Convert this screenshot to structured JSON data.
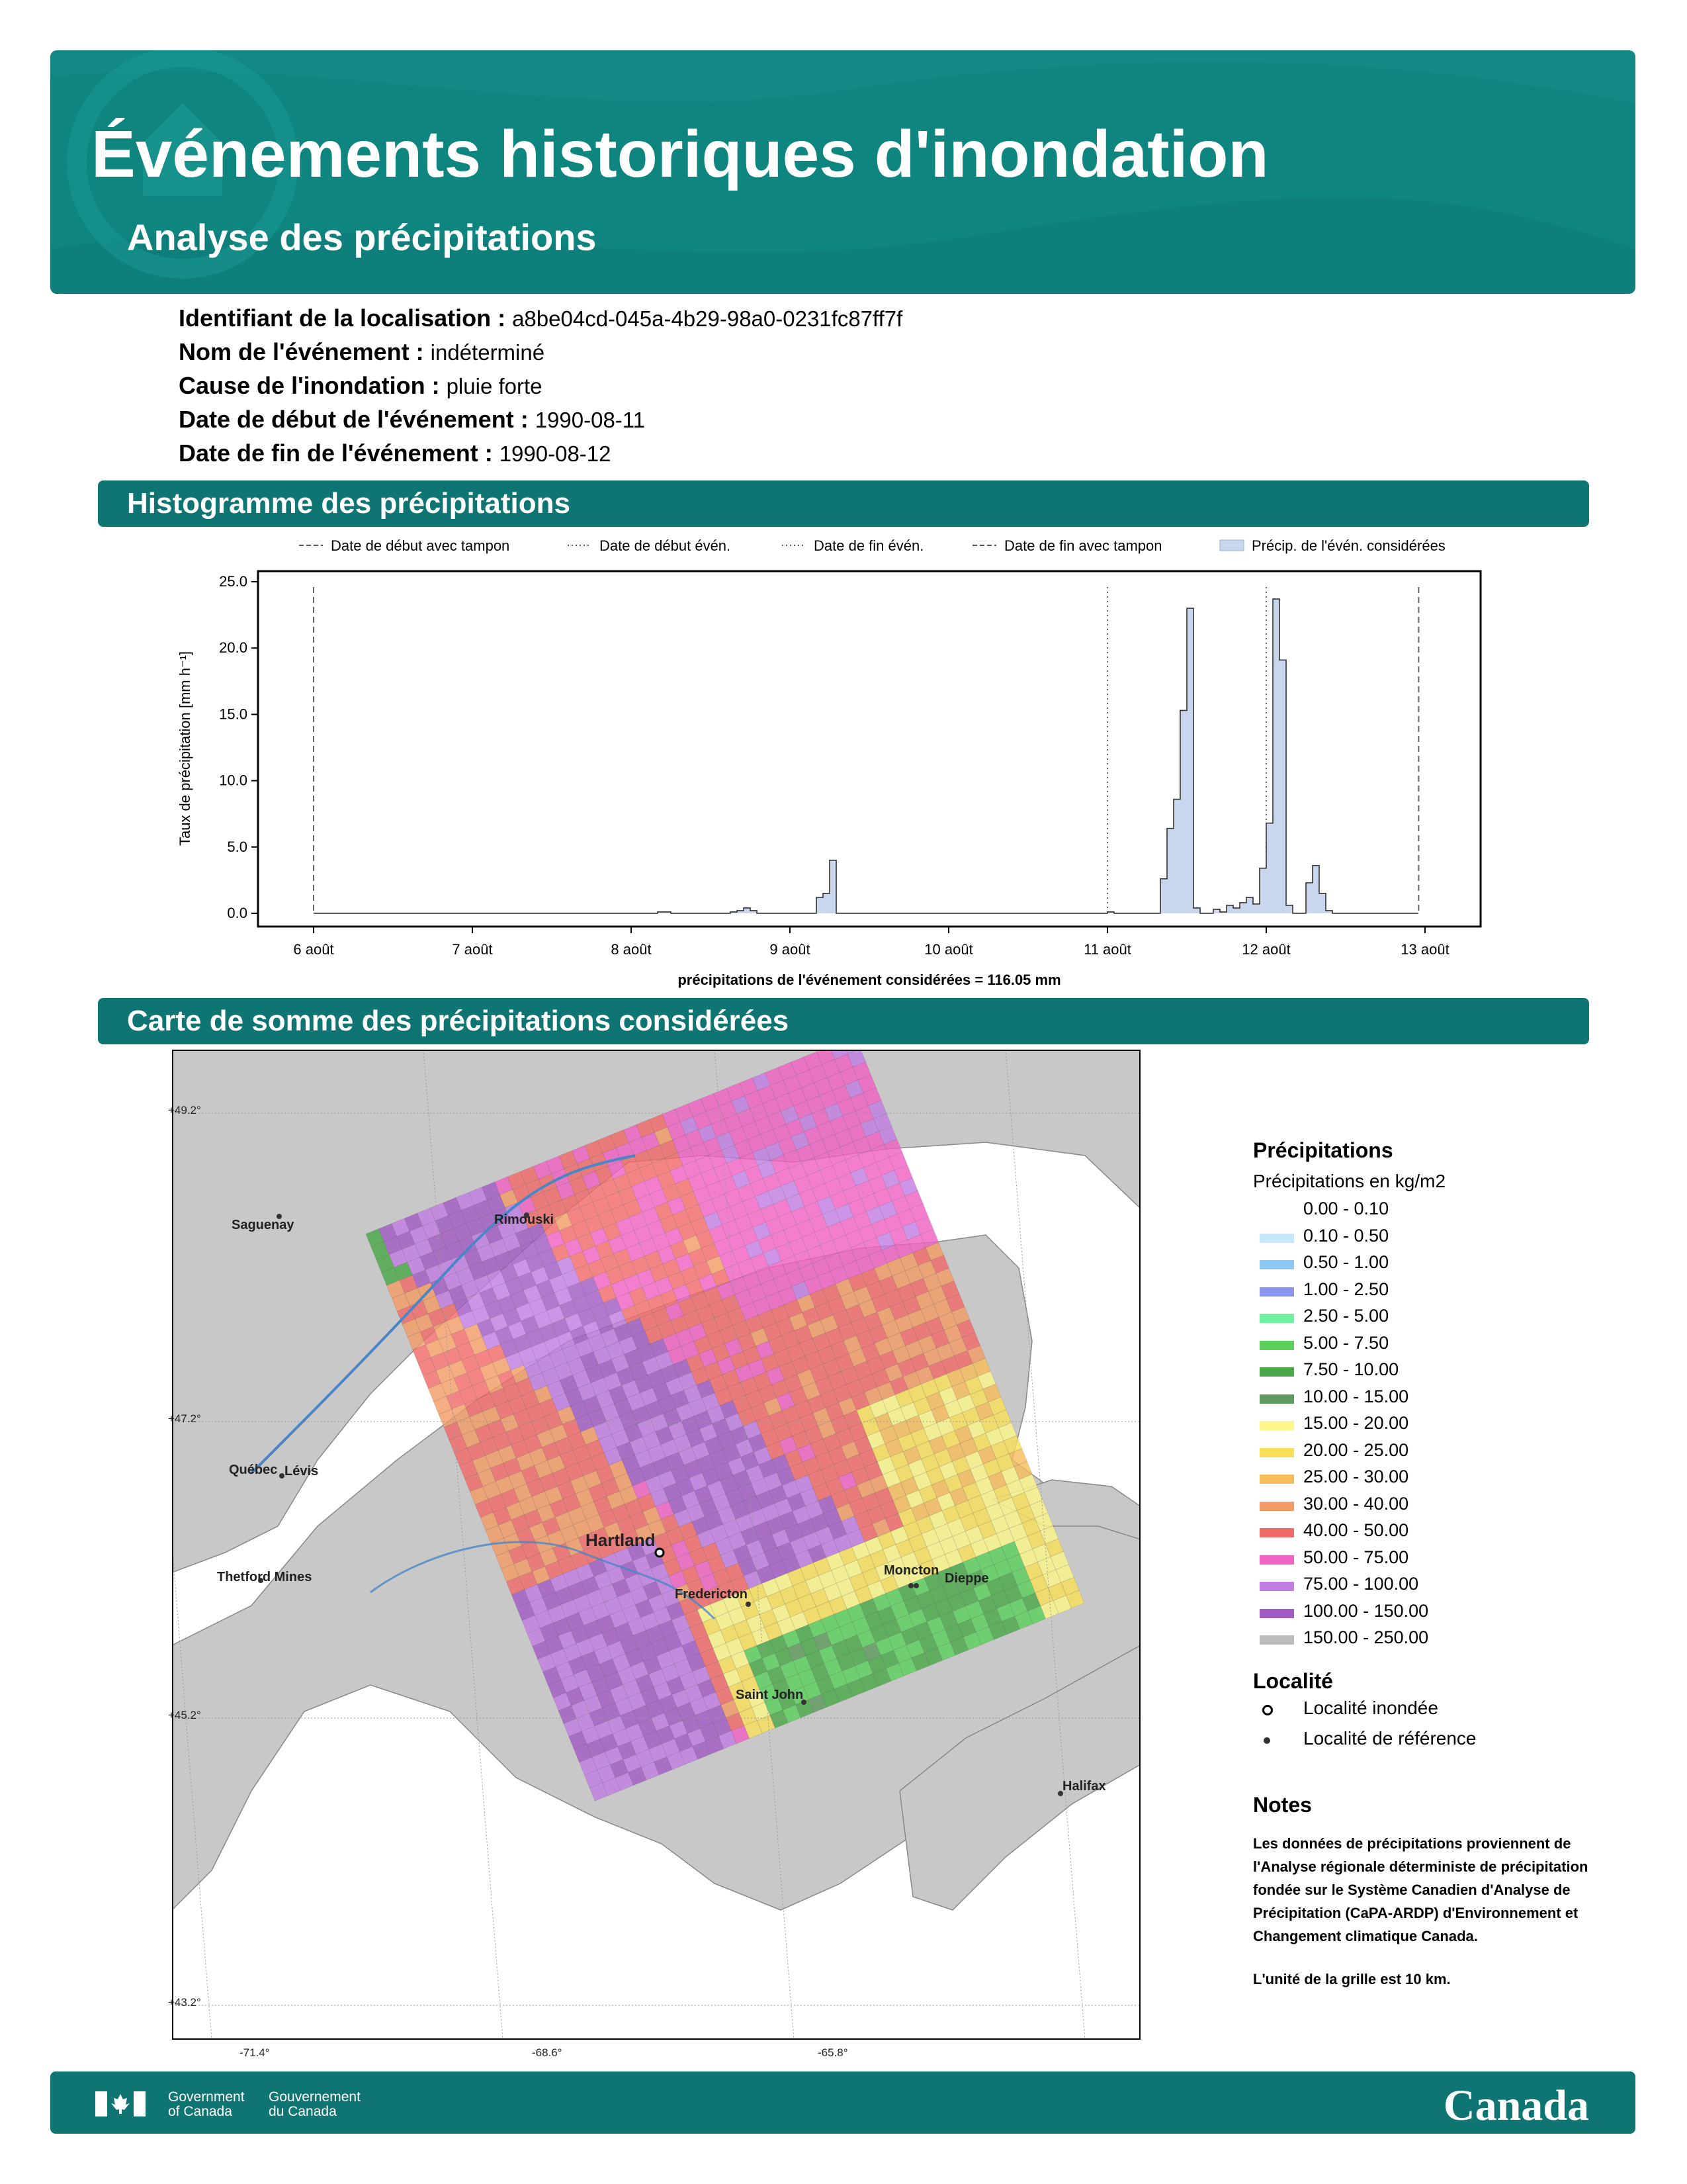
{
  "header": {
    "title": "Événements historiques d'inondation",
    "subtitle": "Analyse des précipitations"
  },
  "info": [
    {
      "label": "Identifiant de la localisation :",
      "value": "a8be04cd-045a-4b29-98a0-0231fc87ff7f"
    },
    {
      "label": "Nom de l'événement :",
      "value": "indéterminé"
    },
    {
      "label": "Cause de l'inondation :",
      "value": "pluie forte"
    },
    {
      "label": "Date de début de l'événement :",
      "value": "1990-08-11"
    },
    {
      "label": "Date de fin de l'événement :",
      "value": "1990-08-12"
    }
  ],
  "sections": {
    "histogram": "Histogramme des précipitations",
    "map": "Carte de somme des précipitations considérées"
  },
  "chart_data": {
    "type": "area",
    "legend": [
      {
        "label": "Date de début avec tampon",
        "style": "dashed"
      },
      {
        "label": "Date de début évén.",
        "style": "dotted"
      },
      {
        "label": "Date de fin évén.",
        "style": "dotted"
      },
      {
        "label": "Date de fin avec tampon",
        "style": "dashed"
      },
      {
        "label": "Précip. de l'évén. considérées",
        "style": "fill"
      }
    ],
    "legend_position": "top",
    "ylabel": "Taux de précipitation [mm h⁻¹]",
    "xlabel": "précipitations de l'événement considérées = 116.05 mm",
    "yticks": [
      "0.0",
      "5.0",
      "10.0",
      "15.0",
      "20.0",
      "25.0"
    ],
    "ylim": [
      -1,
      25.8
    ],
    "xlim_days": [
      5.65,
      13.35
    ],
    "xticks": [
      {
        "day": 6,
        "label": "6 août"
      },
      {
        "day": 7,
        "label": "7 août"
      },
      {
        "day": 8,
        "label": "8 août"
      },
      {
        "day": 9,
        "label": "9 août"
      },
      {
        "day": 10,
        "label": "10 août"
      },
      {
        "day": 11,
        "label": "11 août"
      },
      {
        "day": 12,
        "label": "12 août"
      },
      {
        "day": 13,
        "label": "13 août"
      }
    ],
    "buffer_start_day": 6.0,
    "event_start_day": 11.0,
    "event_end_day": 12.0,
    "buffer_end_day": 12.96,
    "grid": false,
    "series": [
      {
        "values_from_day": 6,
        "step_hours": 1,
        "values": [
          0,
          0,
          0,
          0,
          0,
          0,
          0,
          0,
          0,
          0,
          0,
          0,
          0,
          0,
          0,
          0,
          0,
          0,
          0,
          0,
          0,
          0,
          0,
          0,
          0,
          0,
          0,
          0,
          0,
          0,
          0,
          0,
          0,
          0,
          0,
          0,
          0,
          0,
          0,
          0,
          0,
          0,
          0,
          0,
          0,
          0,
          0,
          0,
          0,
          0,
          0,
          0,
          0.1,
          0.1,
          0,
          0,
          0,
          0,
          0,
          0,
          0,
          0,
          0,
          0.1,
          0.2,
          0.4,
          0.2,
          0,
          0,
          0,
          0,
          0,
          0,
          0,
          0,
          0,
          1.2,
          1.5,
          4.0,
          0,
          0,
          0,
          0,
          0,
          0,
          0,
          0,
          0,
          0,
          0,
          0,
          0,
          0,
          0,
          0,
          0,
          0,
          0,
          0,
          0,
          0,
          0,
          0,
          0,
          0,
          0,
          0,
          0,
          0,
          0,
          0,
          0,
          0,
          0,
          0,
          0,
          0,
          0,
          0,
          0,
          0.1,
          0,
          0,
          0,
          0,
          0,
          0,
          0,
          2.6,
          6.4,
          8.6,
          15.3,
          23.0,
          0.4,
          0,
          0,
          0.3,
          0.1,
          0.6,
          0.4,
          0.8,
          1.2,
          0.7,
          3.4,
          6.8,
          23.7,
          19.1,
          0.6,
          0,
          0,
          2.3,
          3.6,
          1.5,
          0.2,
          0,
          0,
          0,
          0,
          0,
          0,
          0,
          0,
          0,
          0,
          0,
          0,
          0
        ]
      }
    ]
  },
  "map": {
    "cities": [
      {
        "name": "Saguenay"
      },
      {
        "name": "Rimouski"
      },
      {
        "name": "Québec"
      },
      {
        "name": "Lévis"
      },
      {
        "name": "Thetford Mines"
      },
      {
        "name": "Hartland"
      },
      {
        "name": "Fredericton"
      },
      {
        "name": "Moncton"
      },
      {
        "name": "Dieppe"
      },
      {
        "name": "Saint John"
      },
      {
        "name": "Halifax"
      }
    ],
    "lat_labels": [
      "+49.2°",
      "+47.2°",
      "+45.2°",
      "+43.2°"
    ],
    "lon_labels": [
      "-71.4°",
      "-68.6°",
      "-65.8°"
    ]
  },
  "legend": {
    "title": "Précipitations",
    "subtitle": "Précipitations en kg/m2",
    "classes": [
      {
        "label": "0.00 - 0.10",
        "color": "#ffffff"
      },
      {
        "label": "0.10 - 0.50",
        "color": "#c6e6fb"
      },
      {
        "label": "0.50 - 1.00",
        "color": "#8cc8f2"
      },
      {
        "label": "1.00 - 2.50",
        "color": "#8c96ee"
      },
      {
        "label": "2.50 - 5.00",
        "color": "#6ff0a0"
      },
      {
        "label": "5.00 - 7.50",
        "color": "#5ccf5c"
      },
      {
        "label": "7.50 - 10.00",
        "color": "#4aa84a"
      },
      {
        "label": "10.00 - 15.00",
        "color": "#5f9a5f"
      },
      {
        "label": "15.00 - 20.00",
        "color": "#fbf68a"
      },
      {
        "label": "20.00 - 25.00",
        "color": "#f8df5a"
      },
      {
        "label": "25.00 - 30.00",
        "color": "#f6bd5c"
      },
      {
        "label": "30.00 - 40.00",
        "color": "#f39b66"
      },
      {
        "label": "40.00 - 50.00",
        "color": "#f06a6a"
      },
      {
        "label": "50.00 - 75.00",
        "color": "#f062c3"
      },
      {
        "label": "75.00 - 100.00",
        "color": "#c27ee2"
      },
      {
        "label": "100.00 - 150.00",
        "color": "#a15cc4"
      },
      {
        "label": "150.00 - 250.00",
        "color": "#bdbdbd"
      }
    ],
    "locality_title": "Localité",
    "locality_flooded": "Localité inondée",
    "locality_reference": "Localité de référence"
  },
  "notes": {
    "title": "Notes",
    "text": "Les données de précipitations proviennent de l'Analyse régionale déterministe de précipitation fondée sur le Système Canadien d'Analyse de Précipitation (CaPA-ARDP) d'Environnement et Changement climatique Canada.",
    "unit": "L'unité de la grille est 10 km."
  },
  "footer": {
    "gov_en_1": "Government",
    "gov_en_2": "of Canada",
    "gov_fr_1": "Gouvernement",
    "gov_fr_2": "du Canada",
    "wordmark": "Canada"
  }
}
